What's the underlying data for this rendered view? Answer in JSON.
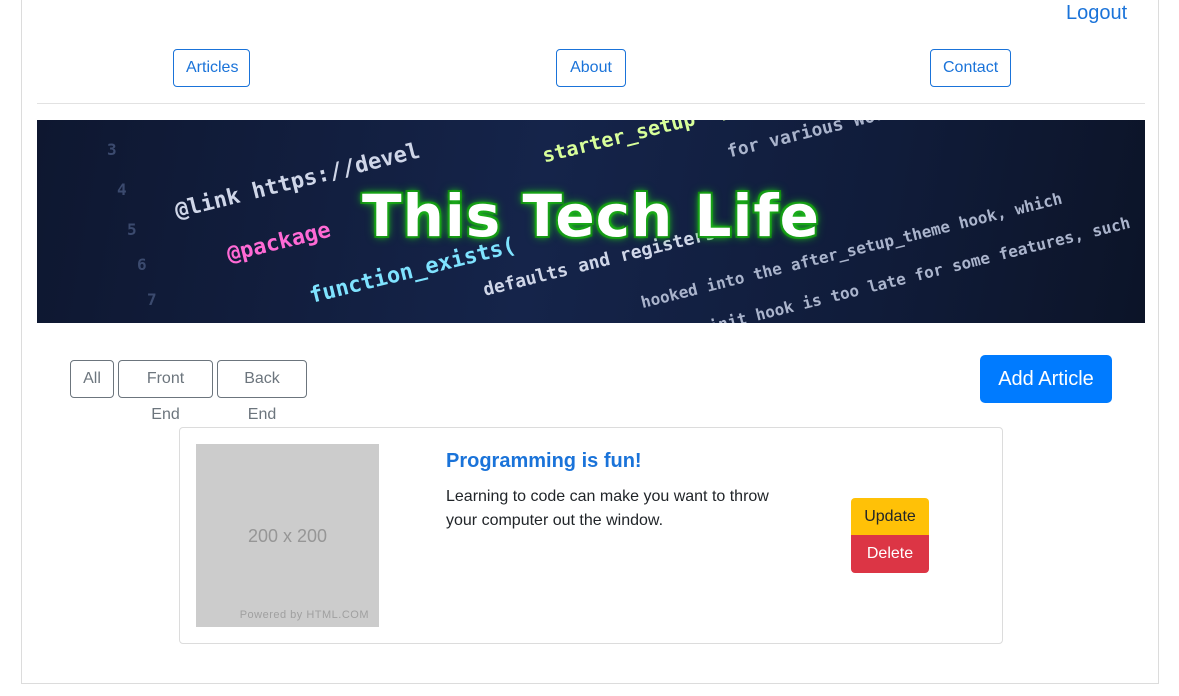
{
  "header": {
    "logout_label": "Logout"
  },
  "nav": {
    "items": [
      {
        "label": "Articles"
      },
      {
        "label": "About"
      },
      {
        "label": "Contact"
      }
    ]
  },
  "banner": {
    "title": "This Tech Life",
    "code_lines": [
      "@link https://devel",
      "@package",
      "function_exists(",
      "starter_setup' ) );",
      "for various WordPress",
      "defaults and registers",
      "hooked into the after_setup_theme hook, which",
      "init hook is too late for some features, such",
      "*/"
    ]
  },
  "filters": {
    "items": [
      {
        "label": "All"
      },
      {
        "label": "Front End"
      },
      {
        "label": "Back End"
      }
    ],
    "add_label": "Add Article"
  },
  "articles": [
    {
      "title": "Programming is fun!",
      "text": "Learning to code can make you want to throw your computer out the window.",
      "image_size_text": "200 x 200",
      "image_credit": "Powered by HTML.COM",
      "update_label": "Update",
      "delete_label": "Delete"
    }
  ]
}
